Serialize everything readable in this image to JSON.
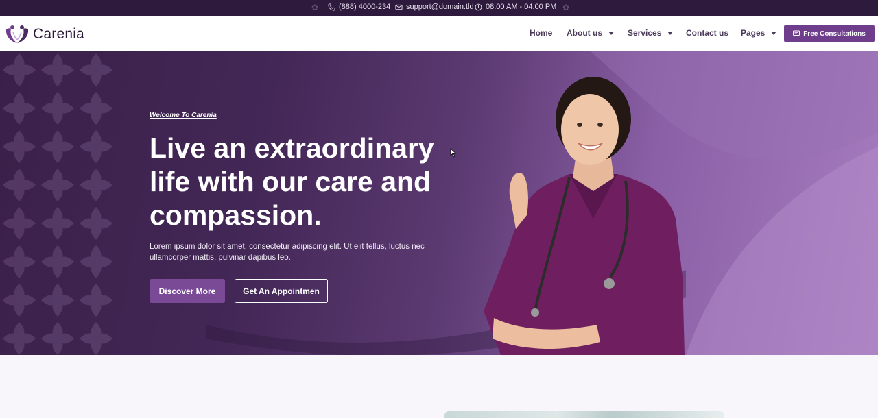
{
  "topbar": {
    "phone": "(888) 4000-234",
    "email": "support@domain.tld",
    "hours": "08.00 AM - 04.00 PM"
  },
  "brand": {
    "name": "Carenia",
    "accent": "#6e3d8c"
  },
  "nav": {
    "items": [
      {
        "label": "Home",
        "has_dropdown": false
      },
      {
        "label": "About us",
        "has_dropdown": true
      },
      {
        "label": "Services",
        "has_dropdown": true
      },
      {
        "label": "Contact us",
        "has_dropdown": false
      },
      {
        "label": "Pages",
        "has_dropdown": true
      }
    ],
    "cta_label": "Free Consultations"
  },
  "hero": {
    "welcome": "Welcome To Carenia",
    "headline": "Live an extraordinary life with our care and compassion.",
    "description": "Lorem ipsum dolor sit amet, consectetur adipiscing elit. Ut elit tellus, luctus nec ullamcorper mattis, pulvinar dapibus leo.",
    "primary_button": "Discover More",
    "secondary_button": "Get An Appointmen"
  }
}
